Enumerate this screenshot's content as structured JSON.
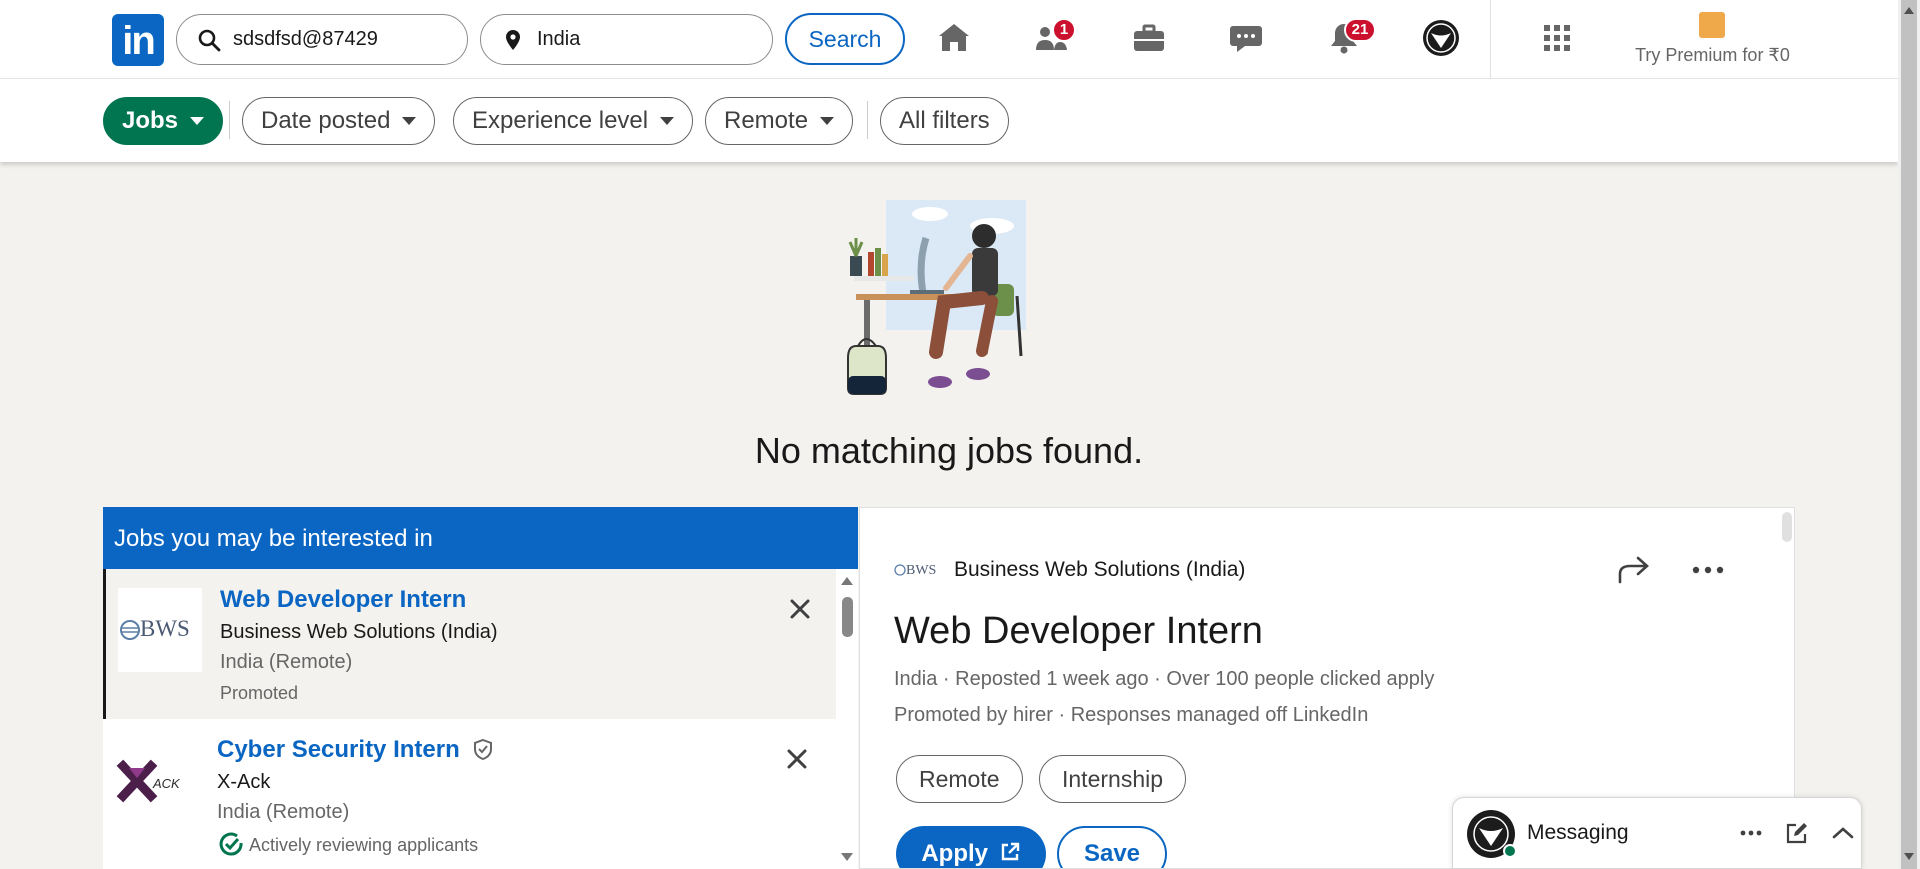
{
  "nav": {
    "search_keywords": "sdsdfsd@87429",
    "search_location": "India",
    "search_button": "Search",
    "network_badge": "1",
    "notifications_badge": "21",
    "premium_label": "Try Premium for ₹0"
  },
  "filters": {
    "jobs": "Jobs",
    "date_posted": "Date posted",
    "experience_level": "Experience level",
    "remote": "Remote",
    "all_filters": "All filters"
  },
  "empty_state": {
    "message": "No matching jobs found."
  },
  "list": {
    "header": "Jobs you may be interested in",
    "items": [
      {
        "title": "Web Developer Intern",
        "company": "Business Web Solutions (India)",
        "location": "India (Remote)",
        "footer": "Promoted",
        "logo_text": "BWS"
      },
      {
        "title": "Cyber Security Intern",
        "company": "X-Ack",
        "location": "India (Remote)",
        "footer": "Actively reviewing applicants",
        "logo_text": "ACK"
      }
    ]
  },
  "detail": {
    "company": "Business Web Solutions (India)",
    "logo_text": "BWS",
    "title": "Web Developer Intern",
    "meta_line1": "India · Reposted 1 week ago · Over 100 people clicked apply",
    "meta_line2": "Promoted by hirer · Responses managed off LinkedIn",
    "tags": [
      "Remote",
      "Internship"
    ],
    "apply": "Apply",
    "save": "Save"
  },
  "messaging": {
    "title": "Messaging"
  },
  "colors": {
    "brand": "#0a66c2",
    "jobs_pill": "#01754f",
    "badge": "#cb112d"
  }
}
